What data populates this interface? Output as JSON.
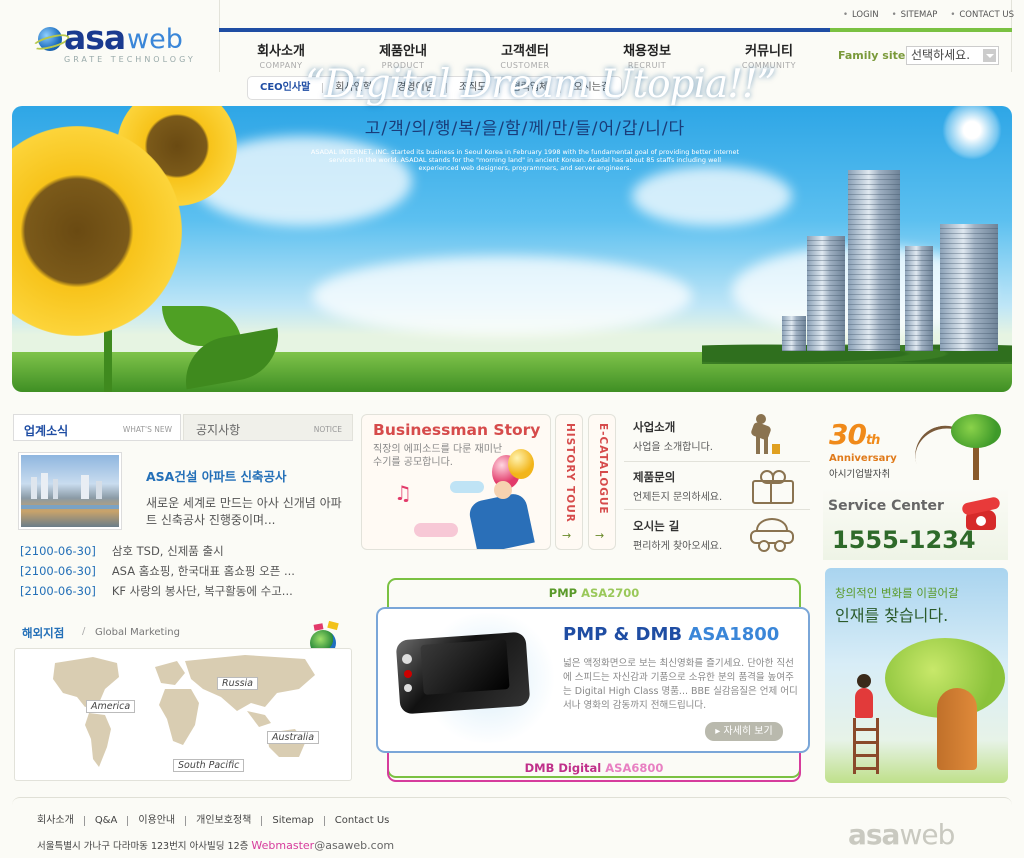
{
  "logo": {
    "brand_a": "asa",
    "brand_b": "web",
    "tagline": "GRATE TECHNOLOGY"
  },
  "top_links": [
    "LOGIN",
    "SITEMAP",
    "CONTACT US"
  ],
  "main_nav": [
    {
      "label": "회사소개",
      "sub": "COMPANY"
    },
    {
      "label": "제품안내",
      "sub": "PRODUCT"
    },
    {
      "label": "고객센터",
      "sub": "CUSTOMER"
    },
    {
      "label": "채용정보",
      "sub": "RECRUIT"
    },
    {
      "label": "커뮤니티",
      "sub": "COMMUNITY"
    }
  ],
  "family_site": {
    "label": "Family site",
    "select_value": "선택하세요."
  },
  "sub_nav": [
    "CEO인사말",
    "회사연혁",
    "경영이념",
    "조직도",
    "협력업체",
    "오시는길"
  ],
  "banner": {
    "title": "“Digital Dream Utopia!!”",
    "subtitle_kr": "고/객/의/행/복/을/함/께/만/들/어/갑/니/다",
    "body": "ASADAL INTERNET, INC. started its business in Seoul Korea in February 1998 with the fundamental goal of providing better internet services in the world. ASADAL stands for the \"morning land\" in ancient Korean. Asadal has about 85 staffs including well experienced web designers, programmers, and server engineers."
  },
  "news": {
    "tab_active": {
      "label": "업계소식",
      "sub": "WHAT'S NEW"
    },
    "tab_inactive": {
      "label": "공지사항",
      "sub": "NOTICE"
    },
    "headline": "ASA건설 아파트 신축공사",
    "description": "새로운 세계로 만드는 아사 신개념 아파트 신축공사 진행중이며...",
    "items": [
      {
        "date": "[2100-06-30]",
        "text": "삼호 TSD, 신제품 출시"
      },
      {
        "date": "[2100-06-30]",
        "text": "ASA 홈쇼핑, 한국대표 홈쇼핑 오픈 ..."
      },
      {
        "date": "[2100-06-30]",
        "text": "KF 사랑의 봉사단, 복구활동에 수고..."
      }
    ]
  },
  "overseas": {
    "title": "해외지점",
    "separator": "/",
    "title_en": "Global Marketing",
    "labels": [
      "Russia",
      "America",
      "Australia",
      "South Pacific"
    ]
  },
  "business": {
    "title": "Businessman Story",
    "desc": "직장의 에피소드를 다룬 재미난 수기를 공모합니다.",
    "tabs": [
      "HISTORY TOUR",
      "E-CATALOGUE"
    ],
    "arrow": "→"
  },
  "services": [
    {
      "title": "사업소개",
      "desc": "사업을 소개합니다."
    },
    {
      "title": "제품문의",
      "desc": "언제든지 문의하세요."
    },
    {
      "title": "오시는 길",
      "desc": "편리하게 찾아오세요."
    }
  ],
  "products": {
    "top": {
      "label": "PMP",
      "model": "ASA2700"
    },
    "main": {
      "label": "PMP & DMB",
      "model": "ASA1800"
    },
    "desc": "넓은 액정화면으로 보는 최신영화를 즐기세요. 단아한 직선에 스피드는 자신감과 기품으로 소유한 분의 품격을 높여주는 Digital High Class 명품... BBE 실감음질은 언제 어디서나 영화의 감동까지 전해드립니다.",
    "button": "자세히 보기",
    "bottom": {
      "label": "DMB Digital",
      "model": "ASA6800"
    }
  },
  "anniversary": {
    "number": "30",
    "suffix": "th",
    "label_en": "Anniversary",
    "label_kr": "아시기업발자취"
  },
  "service_center": {
    "title": "Service Center",
    "phone": "1555-1234"
  },
  "recruit": {
    "line1": "창의적인 변화를 이끌어갈",
    "line2": "인재를 찾습니다."
  },
  "footer": {
    "links": [
      "회사소개",
      "Q&A",
      "이용안내",
      "개인보호정책",
      "Sitemap",
      "Contact Us"
    ],
    "address": "서울특별시 가나구 다라마동 123번지 아사빌딩 12층",
    "webmaster_label": "Webmaster",
    "webmaster_email": "@asaweb.com",
    "logo_a": "asa",
    "logo_b": "web"
  },
  "colors": {
    "primary": "#1f4da3",
    "accent_green": "#7ac142",
    "accent_pink": "#d63c9c",
    "accent_orange": "#f08a1a"
  }
}
